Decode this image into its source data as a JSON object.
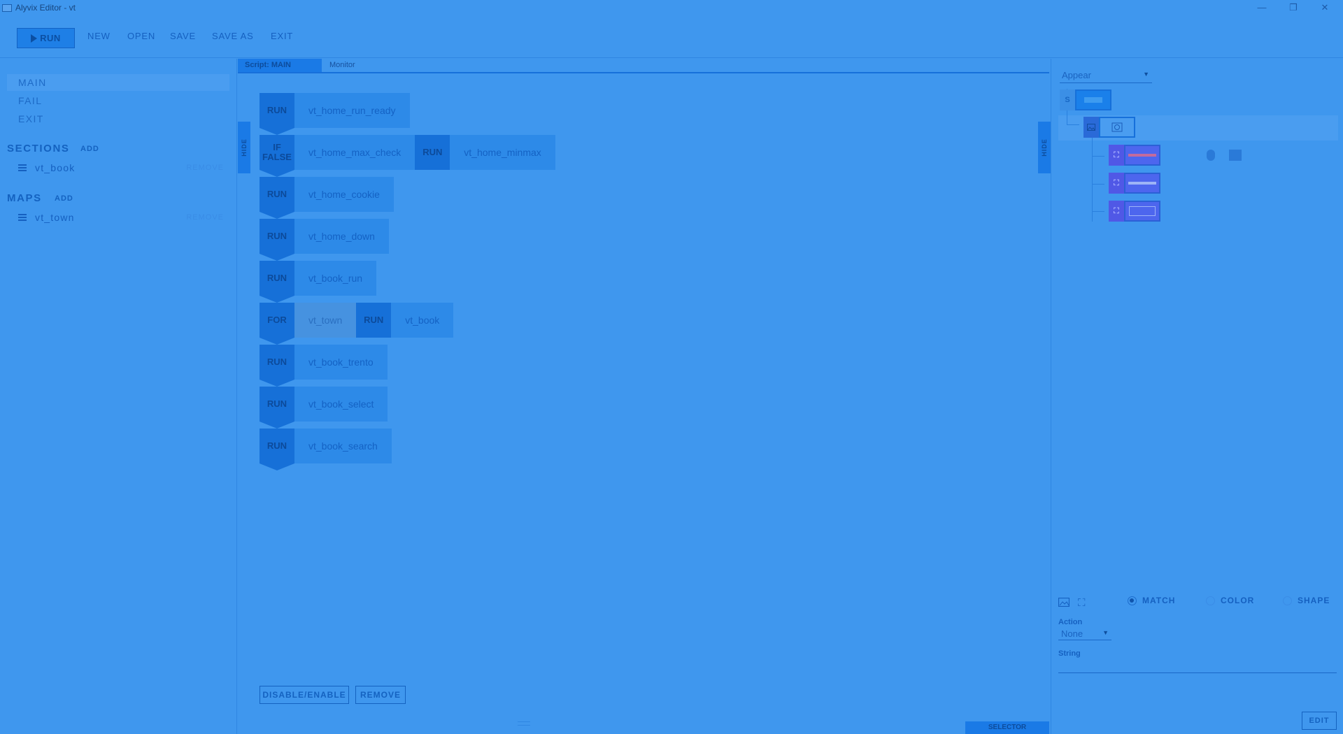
{
  "window": {
    "title": "Alyvix Editor - vt",
    "minimize": "—",
    "restore": "❐",
    "close": "✕"
  },
  "toolbar": {
    "run_label": "RUN",
    "items": [
      "NEW",
      "OPEN",
      "SAVE",
      "SAVE AS",
      "EXIT"
    ]
  },
  "left": {
    "scripts": [
      {
        "label": "MAIN",
        "selected": true
      },
      {
        "label": "FAIL",
        "selected": false
      },
      {
        "label": "EXIT",
        "selected": false
      }
    ],
    "sections_title": "SECTIONS",
    "sections_add": "ADD",
    "sections": [
      {
        "label": "vt_book",
        "remove": "REMOVE"
      }
    ],
    "maps_title": "MAPS",
    "maps_add": "ADD",
    "maps": [
      {
        "label": "vt_town",
        "remove": "REMOVE"
      }
    ]
  },
  "center": {
    "tabs": [
      "Script: MAIN",
      "Monitor"
    ],
    "hide_label": "HIDE",
    "blocks": [
      {
        "badge": "RUN",
        "cells": [
          {
            "text": "vt_home_run_ready"
          }
        ]
      },
      {
        "badge": "IF FALSE",
        "cells": [
          {
            "text": "vt_home_max_check"
          },
          {
            "badge": "RUN"
          },
          {
            "text": "vt_home_minmax"
          }
        ]
      },
      {
        "badge": "RUN",
        "cells": [
          {
            "text": "vt_home_cookie"
          }
        ]
      },
      {
        "badge": "RUN",
        "cells": [
          {
            "text": "vt_home_down"
          }
        ]
      },
      {
        "badge": "RUN",
        "cells": [
          {
            "text": "vt_book_run"
          }
        ]
      },
      {
        "badge": "FOR",
        "cells": [
          {
            "text": "vt_town",
            "dim": true
          },
          {
            "badge": "RUN"
          },
          {
            "text": "vt_book"
          }
        ]
      },
      {
        "badge": "RUN",
        "cells": [
          {
            "text": "vt_book_trento"
          }
        ]
      },
      {
        "badge": "RUN",
        "cells": [
          {
            "text": "vt_book_select"
          }
        ]
      },
      {
        "badge": "RUN",
        "cells": [
          {
            "text": "vt_book_search"
          }
        ]
      }
    ],
    "disable_enable": "DISABLE/ENABLE",
    "remove": "REMOVE",
    "selector": "SELECTOR"
  },
  "right": {
    "mode": "Appear",
    "screen_node_letter": "S",
    "radios": [
      {
        "label": "MATCH",
        "checked": true
      },
      {
        "label": "COLOR",
        "checked": false
      },
      {
        "label": "SHAPE",
        "checked": false
      }
    ],
    "action_label": "Action",
    "action_value": "None",
    "string_label": "String",
    "string_value": "",
    "edit": "EDIT"
  }
}
